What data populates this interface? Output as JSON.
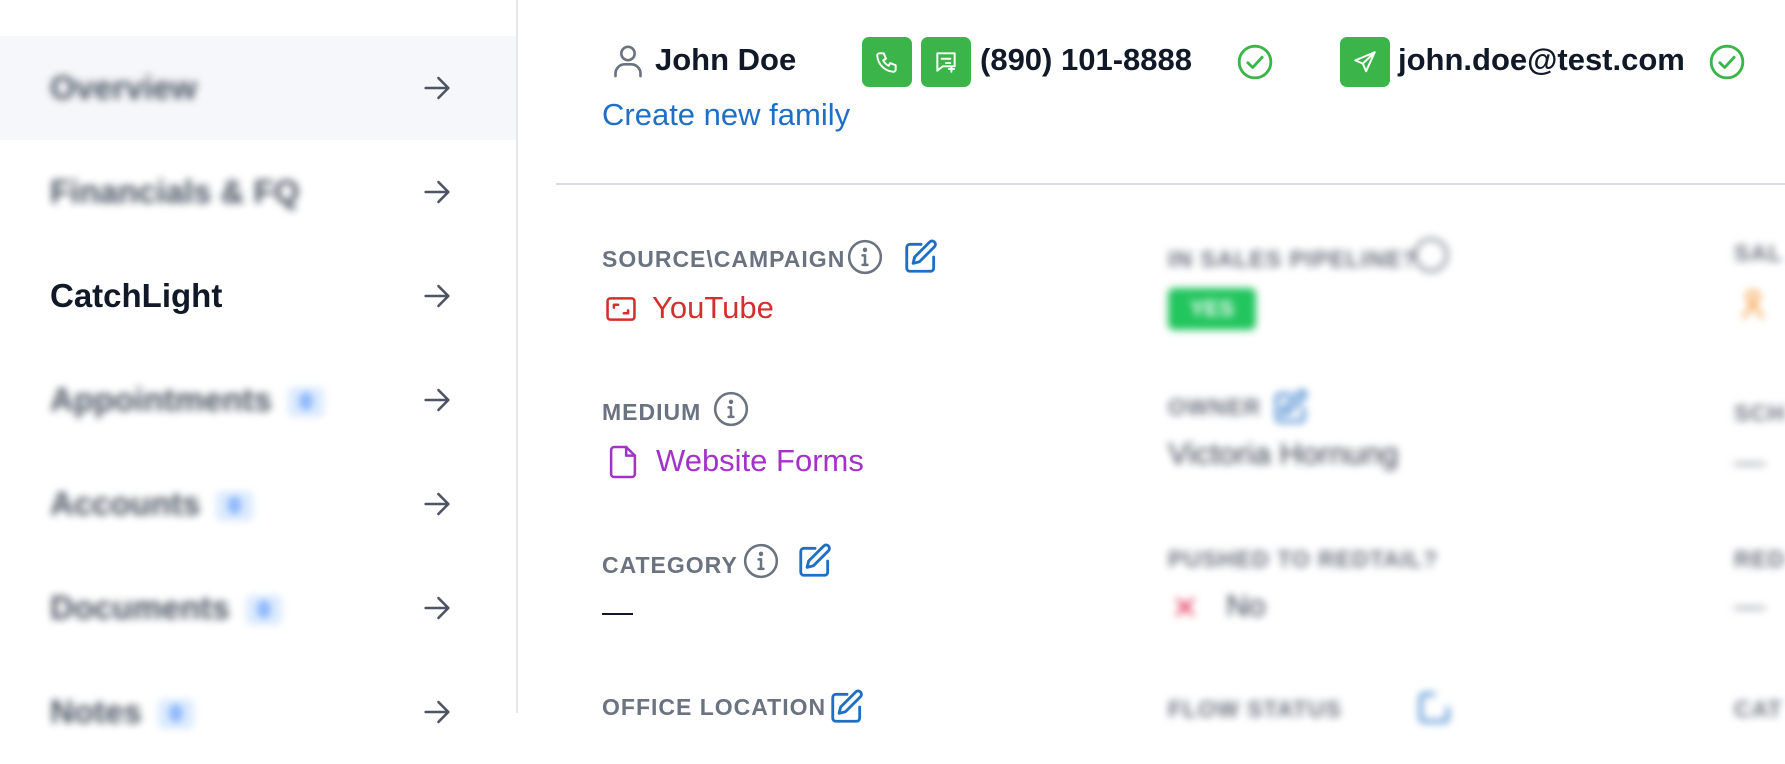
{
  "sidebar": {
    "items": [
      {
        "label": "Overview",
        "badge": null
      },
      {
        "label": "Financials & FQ",
        "badge": null
      },
      {
        "label": "CatchLight",
        "badge": null
      },
      {
        "label": "Appointments",
        "badge": "0"
      },
      {
        "label": "Accounts",
        "badge": "0"
      },
      {
        "label": "Documents",
        "badge": "0"
      },
      {
        "label": "Notes",
        "badge": "0"
      }
    ]
  },
  "header": {
    "name": "John Doe",
    "phone": "(890) 101-8888",
    "email": "john.doe@test.com",
    "create_family": "Create new family"
  },
  "fields": {
    "source_label": "SOURCE\\CAMPAIGN",
    "source_value": "YouTube",
    "medium_label": "MEDIUM",
    "medium_value": "Website Forms",
    "category_label": "CATEGORY",
    "category_value": "—",
    "office_label": "OFFICE LOCATION",
    "pipeline_label": "IN SALES PIPELINE?",
    "pipeline_value": "YES",
    "owner_label": "OWNER",
    "owner_value": "Victoria Hornung",
    "pushed_label": "PUSHED TO REDTAIL?",
    "pushed_value": "No",
    "col3_label1": "SAL",
    "col3_label2": "SCH",
    "col3_value2": "—",
    "col3_label3": "RED",
    "col3_value3": "—",
    "col3_label4": "CAT",
    "col2_label4": "FLOW STATUS"
  },
  "colors": {
    "accent_green": "#3bb54a",
    "link_blue": "#1f6fc5",
    "youtube_red": "#d32f2f",
    "medium_purple": "#a333c8"
  }
}
